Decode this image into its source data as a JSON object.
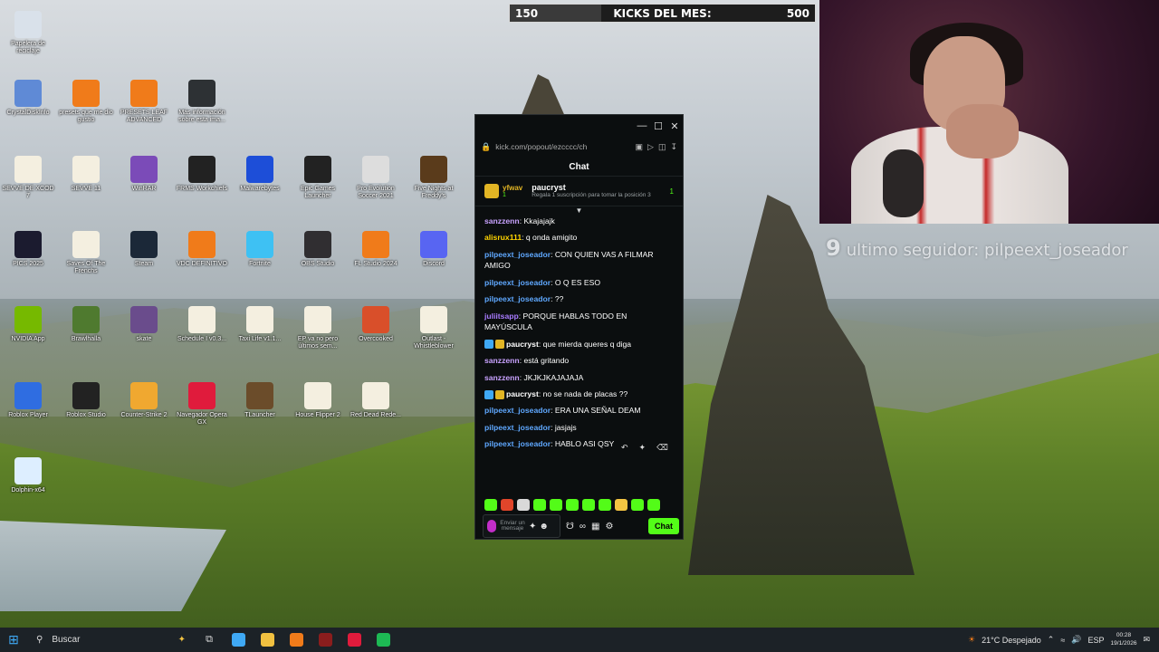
{
  "kicks_bar": {
    "current": "150",
    "title": "KICKS DEL MES:",
    "goal": "500",
    "progress_fraction": 0.3
  },
  "follower_overlay": {
    "number": "9",
    "text": "ultimo seguidor: pilpeext_joseador"
  },
  "desktop_icons": [
    {
      "label": "Papelera de reciclaje",
      "color": "#d9e1ea"
    },
    {
      "label": "CrystalDiskInfo",
      "color": "#5f8ad6"
    },
    {
      "label": "presets que me dio gustio",
      "color": "#f07b1a"
    },
    {
      "label": "PRESETS LEAF ADVANCED",
      "color": "#f07b1a"
    },
    {
      "label": "Más información sobre esta ima...",
      "color": "#2d3134"
    },
    {
      "label": "SEVVE DE XCOD 7",
      "color": "#f4efe0"
    },
    {
      "label": "SEVVE 11",
      "color": "#f4efe0"
    },
    {
      "label": "WinRAR",
      "color": "#7b4bb8"
    },
    {
      "label": "FRMS Workchiefs",
      "color": "#222"
    },
    {
      "label": "Malwarebytes",
      "color": "#1d4ed8"
    },
    {
      "label": "Epic Games Launcher",
      "color": "#222"
    },
    {
      "label": "Pro Evolution Soccer 2021",
      "color": "#ddd"
    },
    {
      "label": "Five Nights at Freddy's",
      "color": "#5a3b1b"
    },
    {
      "label": "PICS 2025",
      "color": "#1b1b2f"
    },
    {
      "label": "Saves Of The Frenchs",
      "color": "#f4efe0"
    },
    {
      "label": "Steam",
      "color": "#1b2838"
    },
    {
      "label": "VDC DEFINITIVO",
      "color": "#f07b1a"
    },
    {
      "label": "Fortnite",
      "color": "#3ec1f3"
    },
    {
      "label": "OBS Studio",
      "color": "#302e31"
    },
    {
      "label": "FL Studio 2024",
      "color": "#f07b1a"
    },
    {
      "label": "Discord",
      "color": "#5865f2"
    },
    {
      "label": "NVIDIA App",
      "color": "#76b900"
    },
    {
      "label": "Brawlhalla",
      "color": "#4f7a2f"
    },
    {
      "label": "skate",
      "color": "#6a4c8c"
    },
    {
      "label": "Schedule I v0.3...",
      "color": "#f4efe0"
    },
    {
      "label": "Taxi Life v1.1...",
      "color": "#f4efe0"
    },
    {
      "label": "EP va no pero últimos sem...",
      "color": "#f4efe0"
    },
    {
      "label": "Overcooked",
      "color": "#d94f2a"
    },
    {
      "label": "Outlast - Whistleblower",
      "color": "#f4efe0"
    },
    {
      "label": "Roblox Player",
      "color": "#2f6de1"
    },
    {
      "label": "Roblox Studio",
      "color": "#222"
    },
    {
      "label": "Counter-Strike 2",
      "color": "#f0a830"
    },
    {
      "label": "Navegador Opera GX",
      "color": "#e01b3c"
    },
    {
      "label": "TLauncher",
      "color": "#6b4c2a"
    },
    {
      "label": "House Flipper 2",
      "color": "#f4efe0"
    },
    {
      "label": "Red Dead Rede...",
      "color": "#f4efe0"
    },
    {
      "label": "Dolphin-x64",
      "color": "#ddeeff"
    }
  ],
  "chat_window": {
    "url": "kick.com/popout/ezcccc/ch",
    "title": "Chat",
    "pinned": {
      "gifter": "yfwav",
      "gifter_count": "1",
      "subscriber": "paucryst",
      "sub_count": "1",
      "note": "Regala 1 suscripción para tomar la posición 3"
    },
    "messages": [
      {
        "user": "sanzzenn",
        "color": "#c8a2ff",
        "text": "Kkajajajk",
        "badges": []
      },
      {
        "user": "alisrux111",
        "color": "#ffd400",
        "text": "q onda amigito",
        "badges": []
      },
      {
        "user": "pilpeext_joseador",
        "color": "#5fa8ff",
        "text": "CON QUIEN VAS A FILMAR AMIGO",
        "badges": []
      },
      {
        "user": "pilpeext_joseador",
        "color": "#5fa8ff",
        "text": "O Q ES ESO",
        "badges": []
      },
      {
        "user": "pilpeext_joseador",
        "color": "#5fa8ff",
        "text": "??",
        "badges": []
      },
      {
        "user": "juliitsapp",
        "color": "#a87bff",
        "text": "PORQUE HABLAS TODO EN MAYÚSCULA",
        "badges": []
      },
      {
        "user": "paucryst",
        "color": "#ffffff",
        "text": "que mierda queres q diga",
        "badges": [
          "#3fa9f5",
          "#e2b524"
        ]
      },
      {
        "user": "sanzzenn",
        "color": "#c8a2ff",
        "text": "está gritando",
        "badges": []
      },
      {
        "user": "sanzzenn",
        "color": "#c8a2ff",
        "text": "JKJKJKAJAJAJA",
        "badges": []
      },
      {
        "user": "paucryst",
        "color": "#ffffff",
        "text": "no se nada de placas ??",
        "badges": [
          "#3fa9f5",
          "#e2b524"
        ]
      },
      {
        "user": "pilpeext_joseador",
        "color": "#5fa8ff",
        "text": "ERA UNA SEÑAL DEAM",
        "badges": []
      },
      {
        "user": "pilpeext_joseador",
        "color": "#5fa8ff",
        "text": "jasjajs",
        "badges": []
      },
      {
        "user": "pilpeext_joseador",
        "color": "#5fa8ff",
        "text": "HABLO ASI QSY",
        "badges": []
      }
    ],
    "emotes": [
      "#53fc18",
      "#e0452a",
      "#d9d9d9",
      "#53fc18",
      "#53fc18",
      "#53fc18",
      "#53fc18",
      "#53fc18",
      "#f4c542",
      "#53fc18",
      "#53fc18"
    ],
    "input_placeholder": "Enviar un mensaje",
    "send_label": "Chat"
  },
  "taskbar": {
    "search_label": "Buscar",
    "apps": [
      "#3fa9f5",
      "#f0c040",
      "#f07b1a",
      "#8b1d1d",
      "#e01b3c",
      "#1db954"
    ],
    "weather": "21°C Despejado",
    "language": "ESP",
    "time": "00:28",
    "date": "19/1/2026",
    "accent_color": "#53fc18"
  }
}
